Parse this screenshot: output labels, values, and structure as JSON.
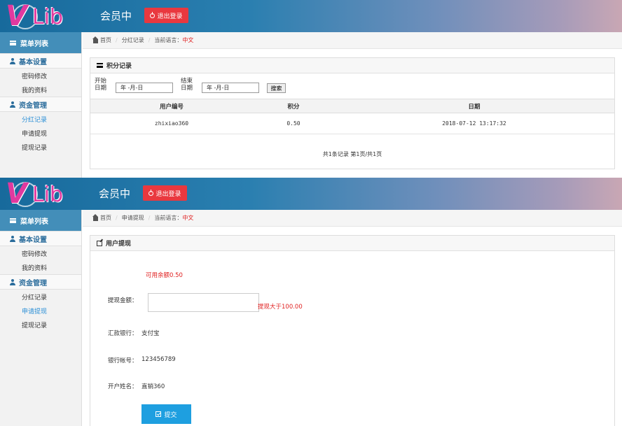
{
  "screen1": {
    "app": {
      "logo": "VLib",
      "logo_v": "V",
      "logo_lib": "Lib",
      "title": "会员中",
      "logout_label": "退出登录"
    },
    "sidebar": {
      "menu_title": "菜单列表",
      "groups": [
        {
          "label": "基本设置",
          "items": [
            "密码修改",
            "我的资料"
          ]
        },
        {
          "label": "资金管理",
          "items": [
            "分红记录",
            "申请提现",
            "提现记录"
          ],
          "active": "分红记录"
        }
      ]
    },
    "breadcrumb": {
      "home": "首页",
      "current": "分红记录",
      "lang_label": "当前语言：",
      "lang_value": "中文"
    },
    "panel_title": "积分记录",
    "filters": {
      "start_label": "开始日期",
      "end_label": "结束日期",
      "start_placeholder": "年 -月-日",
      "end_placeholder": "年 -月-日",
      "search_label": "搜索"
    },
    "table": {
      "columns": [
        "用户编号",
        "积分",
        "日期"
      ],
      "rows": [
        [
          "zhixiao360",
          "0.50",
          "2018-07-12 13:17:32"
        ]
      ]
    },
    "pager": "共1条记录 第1页/共1页"
  },
  "screen2": {
    "app": {
      "logo": "VLib",
      "logo_v": "V",
      "logo_lib": "Lib",
      "title": "会员中",
      "logout_label": "退出登录"
    },
    "sidebar": {
      "menu_title": "菜单列表",
      "groups": [
        {
          "label": "基本设置",
          "items": [
            "密码修改",
            "我的资料"
          ]
        },
        {
          "label": "资金管理",
          "items": [
            "分红记录",
            "申请提现",
            "提现记录"
          ],
          "active": "申请提现"
        }
      ]
    },
    "breadcrumb": {
      "home": "首页",
      "current": "申请提现",
      "lang_label": "当前语言：",
      "lang_value": "中文"
    },
    "panel_title": "用户提现",
    "form": {
      "balance": "可用余额0.50",
      "amount_label": "提现金额：",
      "amount_hint": "提现大于100.00",
      "bank_label": "汇款银行：",
      "bank_value": "支付宝",
      "account_label": "银行帐号：",
      "account_value": "123456789",
      "name_label": "开户姓名：",
      "name_value": "直销360",
      "submit_label": "提交"
    }
  },
  "colors": {
    "header_start": "#176a9c",
    "accent_blue": "#438eb9",
    "logout_red": "#e9383f",
    "submit_blue": "#1e9fe0",
    "logo_pink": "#e1399f"
  }
}
